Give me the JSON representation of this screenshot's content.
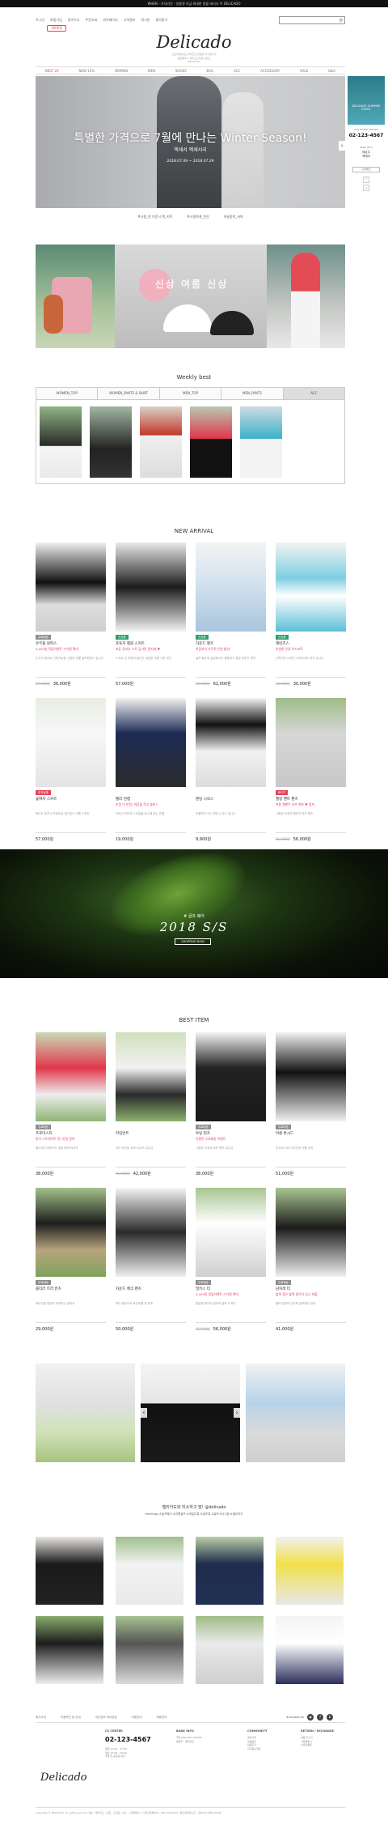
{
  "topbar": {
    "text": "WHEN - 기다리던 - 실용정 지금 최대한 몸을 버티다 주 DELICADO"
  },
  "util_nav": [
    "로그인",
    "회원가입",
    "장바구니",
    "주문조회",
    "마이페이지",
    "고객센터",
    "게시판",
    "즐겨찾기"
  ],
  "join_badge": "2000원",
  "search": {
    "placeholder": ""
  },
  "logo": "Delicado",
  "logo_sub": [
    "스포티하면서도 우아한 스타일을 추구합니다",
    "골프웨어 & 라이프스타일 브랜드",
    "DELICADO"
  ],
  "main_nav": [
    "BEST 20",
    "NEW 15%",
    "WOMEN",
    "MEN",
    "SHOES",
    "BAG",
    "ACC",
    "ACCESSORY",
    "SALE",
    "Q&A"
  ],
  "hero": {
    "title": "특별한 가격으로 7월에 만나는 Winter Season!",
    "subtitle": "액세서 액세서리",
    "dates": "2018.07.09 ~ 2018.07.29"
  },
  "hero_tabs": [
    "#시원_한 더운시 맨_키트",
    "#시원하게_만산",
    "#골동한_서약"
  ],
  "quick": {
    "ad": "DELICADO SUMMER EVENT",
    "cs_label": "CUSTOMER CENTER",
    "phone": "02-123-4567",
    "bank_label": "BANK INFO",
    "bank_lines": [
      "예금주",
      "백에러"
    ],
    "button": "출석체크"
  },
  "promo_mid_text": "신상 여름 신상",
  "weekly_best": {
    "title": "Weekly best",
    "tabs": [
      "WOMEN_TOP",
      "WOMEN_PANTS & SKIRT",
      "MEN_TOP",
      "MEN_PANTS",
      "ACC"
    ]
  },
  "new_arrival": {
    "title": "NEW ARRIVAL",
    "products": [
      {
        "badge": "무료배송",
        "name": "유무플 원피스",
        "desc": "5,000원 적립이벤트 기가필 확대",
        "note": "두가지 컬러로 선택가능한 시원한 여름 골프원피스 입니다",
        "old": "67,000원",
        "price": "36,000원"
      },
      {
        "badge": "신상품",
        "name": "포튜지 랩원 스커트",
        "desc": "포튜 퓨지추 스트 담가된 멋지게 ♥",
        "note": "스커트 뒤 포켓이 들어간 세련된 여름 시즌 멋진",
        "old": "",
        "price": "57,000원"
      },
      {
        "badge": "신상품",
        "name": "하운드 팬츠",
        "desc": "착장부터 가득적 인한 할인!",
        "note": "골프 필드와 일상에서도 활용하기 좋은 하운드 팬츠",
        "old": "65,000원",
        "price": "62,000원"
      },
      {
        "badge": "신상품",
        "name": "헤린즈스",
        "desc": "유일한 유일 하드코트",
        "note": "신학적인 디자인 스트라이프 셔츠 입니다",
        "old": "33,000원",
        "price": "30,000원"
      },
      {
        "badge": "추천상품",
        "name": "꽃여자 스커트",
        "desc": "",
        "note": "화이트 꽃무늬 프린트로 생기있는 여름 스커트",
        "old": "",
        "price": "57,000원"
      },
      {
        "badge": "",
        "name": "벨라 썬캡",
        "desc": "만점 더 만점! 마음을 적고 불러!!",
        "note": "자외선 차단과 스타일을 동시에 잡는 썬캡",
        "old": "",
        "price": "19,000원"
      },
      {
        "badge": "",
        "name": "밴딩 니삭스",
        "desc": "",
        "note": "무릎까지 오는 밴딩 니삭스 입니다",
        "old": "",
        "price": "9,900원"
      },
      {
        "badge": "BEST",
        "name": "멜랑 팬트 팬츠",
        "desc": "여름 멜팬트 하프 팬츠 ♥ 멋져",
        "note": "시원한 소재의 멜란지 하프 팬츠",
        "old": "61,000원",
        "price": "56,000원"
      }
    ]
  },
  "banner": {
    "label": "# 골프 웨어",
    "title": "2018 S/S",
    "button": "SHOPPING NOW"
  },
  "best_item": {
    "title": "BEST ITEM",
    "products": [
      {
        "badge": "무료배송",
        "name": "프로미스티",
        "desc": "한국 스트레이트 핏! 만원 멋져",
        "note": "필드에서 돋보이는 컬러 배색 티셔츠",
        "old": "",
        "price": "38,000원"
      },
      {
        "badge": "",
        "name": "라임반트",
        "desc": "",
        "note": "라인 포인트 피케 티셔츠 입니다",
        "old": "45,000원",
        "price": "42,000원"
      },
      {
        "badge": "무료배송",
        "name": "투팅 핀츠",
        "desc": "유용한 무료배송 이벤트",
        "note": "시원한 소재의 하프 팬츠 입니다",
        "old": "",
        "price": "38,000원"
      },
      {
        "badge": "무료배송",
        "name": "마름 톤시드",
        "desc": "",
        "note": "민소매 니트 디자인의 여름 상의",
        "old": "",
        "price": "51,000원"
      },
      {
        "badge": "무료배송",
        "name": "플더러 트라 반츠",
        "desc": "",
        "note": "베이직한 컬러의 트레이닝 반바지",
        "old": "",
        "price": "29,000원"
      },
      {
        "badge": "",
        "name": "자운드 체크 팬츠",
        "desc": "",
        "note": "체크 패턴으로 포인트를 준 팬츠",
        "old": "",
        "price": "50,000원"
      },
      {
        "badge": "무료배송",
        "name": "밀키스 티",
        "desc": "5,000원 정립이벤트 기가필 확대",
        "note": "깔끔한 화이트 컬러의 골프 티셔츠",
        "old": "61,000원",
        "price": "56,000원"
      },
      {
        "badge": "무료배송",
        "name": "남자색 티",
        "desc": "블랙 같은 블랙 빛이다 입고 퍼즐",
        "note": "블랙 컬러의 민소매 골프웨어 상의",
        "old": "",
        "price": "41,000원"
      }
    ]
  },
  "instagram": {
    "title": "델리카도와 미소하고 말! @delicado",
    "subtitle": "Hashtags #골프웨어 #여름골프 #데일리룩 #골프룩 #골프스타그램 #델리카도"
  },
  "footer": {
    "nav": [
      "회사소개",
      "이용약관 및 안내",
      "개인정보 처리방침",
      "이용안내",
      "제휴문의"
    ],
    "social_tag": "#cocotee.ok",
    "logo": "Delicado",
    "cs_title": "CS CENTER",
    "phone": "02-123-4567",
    "cs_lines": [
      "평일 10:00 - 17:00",
      "점심 12:00 - 13:00",
      "주말 및 공휴일 휴무"
    ],
    "bank_title": "BANK INFO",
    "bank_lines": [
      "국민 000-000-000000",
      "예금주 : 델리카도"
    ],
    "community_title": "COMMUNITY",
    "community_lines": [
      "공지사항",
      "상품문의",
      "상품후기",
      "자주묻는질문"
    ],
    "return_title": "RETURN / EXCHANGE",
    "return_lines": [
      "반품 주소지",
      "서울특별시",
      "CJ대한통운"
    ],
    "copyright": "Copyright © DELICADO All rights reserved. 상호 : 델리카도 | 대표 : 홍길동 | 주소 : 서울특별시 | 사업자등록번호 : 000-00-00000 | 통신판매업신고 : 제0000-서울-0000호"
  }
}
